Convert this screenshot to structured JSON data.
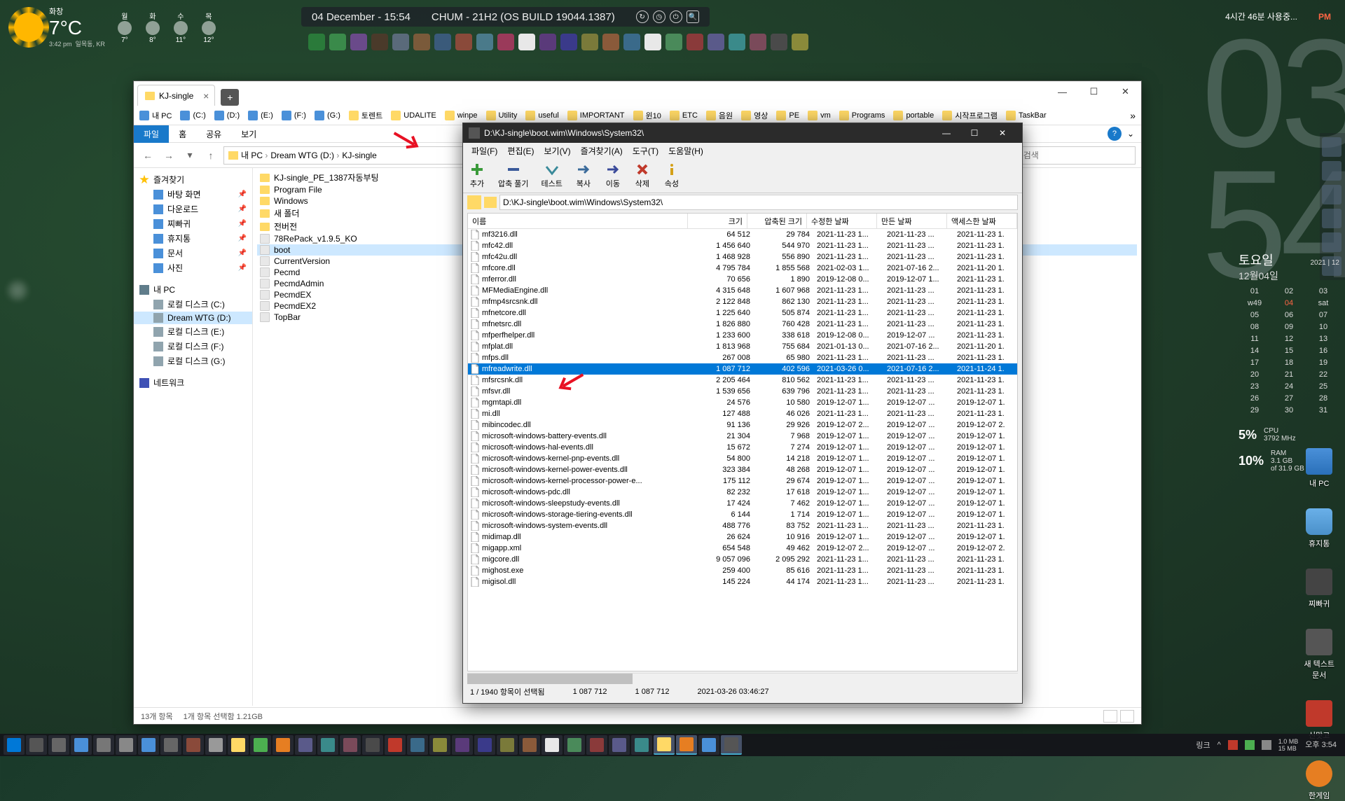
{
  "topbar": {
    "weather_day": "화창",
    "temp": "7°C",
    "sub1": "3:42 pm",
    "sub2": "일목동, KR",
    "forecast_days": [
      "월",
      "화",
      "수",
      "목"
    ],
    "forecast_temps": [
      "7°",
      "8°",
      "11°",
      "12°"
    ],
    "datetime": "04 December - 15:54",
    "build": "CHUM - 21H2 (OS BUILD 19044.1387)",
    "uptime": "4시간 46분 사용중...",
    "pm": "PM"
  },
  "bigclock": {
    "h": "03",
    "m": "54"
  },
  "explorer": {
    "tab_title": "KJ-single",
    "bookmarks": [
      "내 PC",
      "(C:)",
      "(D:)",
      "(E:)",
      "(F:)",
      "(G:)",
      "토렌트",
      "UDALITE",
      "winpe",
      "Utility",
      "useful",
      "IMPORTANT",
      "윈10",
      "ETC",
      "음원",
      "영상",
      "PE",
      "vm",
      "Programs",
      "portable",
      "시작프로그램",
      "TaskBar"
    ],
    "ribbon": [
      "파일",
      "홈",
      "공유",
      "보기"
    ],
    "breadcrumb": [
      "내 PC",
      "Dream WTG (D:)",
      "KJ-single"
    ],
    "search_placeholder": "KJ-single 검색",
    "sidebar": {
      "quick": "즐겨찾기",
      "quick_items": [
        "바탕 화면",
        "다운로드",
        "찌빠귀",
        "휴지통",
        "문서",
        "사진"
      ],
      "pc": "내 PC",
      "drives": [
        "로컬 디스크 (C:)",
        "Dream WTG (D:)",
        "로컬 디스크 (E:)",
        "로컬 디스크 (F:)",
        "로컬 디스크 (G:)"
      ],
      "network": "네트워크"
    },
    "files": [
      {
        "n": "KJ-single_PE_1387자동부팅",
        "t": "fld"
      },
      {
        "n": "Program File",
        "t": "fld"
      },
      {
        "n": "Windows",
        "t": "fld"
      },
      {
        "n": "새 폴더",
        "t": "fld"
      },
      {
        "n": "전버전",
        "t": "fld"
      },
      {
        "n": "78RePack_v1.9.5_KO",
        "t": "fil"
      },
      {
        "n": "boot",
        "t": "fil",
        "sel": true
      },
      {
        "n": "CurrentVersion",
        "t": "fil"
      },
      {
        "n": "Pecmd",
        "t": "fil"
      },
      {
        "n": "PecmdAdmin",
        "t": "fil"
      },
      {
        "n": "PecmdEX",
        "t": "fil"
      },
      {
        "n": "PecmdEX2",
        "t": "fil"
      },
      {
        "n": "TopBar",
        "t": "fil"
      }
    ],
    "status1": "13개 항목",
    "status2": "1개 항목 선택함 1.21GB"
  },
  "zip": {
    "title": "D:\\KJ-single\\boot.wim\\Windows\\System32\\",
    "menu": [
      "파일(F)",
      "편집(E)",
      "보기(V)",
      "즐겨찾기(A)",
      "도구(T)",
      "도움말(H)"
    ],
    "tools": [
      "추가",
      "압축 풀기",
      "테스트",
      "복사",
      "이동",
      "삭제",
      "속성"
    ],
    "addr": "D:\\KJ-single\\boot.wim\\Windows\\System32\\",
    "headers": [
      "이름",
      "크기",
      "압축된 크기",
      "수정한 날짜",
      "만든 날짜",
      "액세스한 날짜"
    ],
    "rows": [
      {
        "n": "mf3216.dll",
        "s": "64 512",
        "p": "29 784",
        "m": "2021-11-23 1...",
        "c": "2021-11-23 ...",
        "a": "2021-11-23 1."
      },
      {
        "n": "mfc42.dll",
        "s": "1 456 640",
        "p": "544 970",
        "m": "2021-11-23 1...",
        "c": "2021-11-23 ...",
        "a": "2021-11-23 1."
      },
      {
        "n": "mfc42u.dll",
        "s": "1 468 928",
        "p": "556 890",
        "m": "2021-11-23 1...",
        "c": "2021-11-23 ...",
        "a": "2021-11-23 1."
      },
      {
        "n": "mfcore.dll",
        "s": "4 795 784",
        "p": "1 855 568",
        "m": "2021-02-03 1...",
        "c": "2021-07-16 2...",
        "a": "2021-11-20 1."
      },
      {
        "n": "mferror.dll",
        "s": "70 656",
        "p": "1 890",
        "m": "2019-12-08 0...",
        "c": "2019-12-07 1...",
        "a": "2021-11-23 1."
      },
      {
        "n": "MFMediaEngine.dll",
        "s": "4 315 648",
        "p": "1 607 968",
        "m": "2021-11-23 1...",
        "c": "2021-11-23 ...",
        "a": "2021-11-23 1."
      },
      {
        "n": "mfmp4srcsnk.dll",
        "s": "2 122 848",
        "p": "862 130",
        "m": "2021-11-23 1...",
        "c": "2021-11-23 ...",
        "a": "2021-11-23 1."
      },
      {
        "n": "mfnetcore.dll",
        "s": "1 225 640",
        "p": "505 874",
        "m": "2021-11-23 1...",
        "c": "2021-11-23 ...",
        "a": "2021-11-23 1."
      },
      {
        "n": "mfnetsrc.dll",
        "s": "1 826 880",
        "p": "760 428",
        "m": "2021-11-23 1...",
        "c": "2021-11-23 ...",
        "a": "2021-11-23 1."
      },
      {
        "n": "mfperfhelper.dll",
        "s": "1 233 600",
        "p": "338 618",
        "m": "2019-12-08 0...",
        "c": "2019-12-07 ...",
        "a": "2021-11-23 1."
      },
      {
        "n": "mfplat.dll",
        "s": "1 813 968",
        "p": "755 684",
        "m": "2021-01-13 0...",
        "c": "2021-07-16 2...",
        "a": "2021-11-20 1."
      },
      {
        "n": "mfps.dll",
        "s": "267 008",
        "p": "65 980",
        "m": "2021-11-23 1...",
        "c": "2021-11-23 ...",
        "a": "2021-11-23 1."
      },
      {
        "n": "mfreadwrite.dll",
        "s": "1 087 712",
        "p": "402 596",
        "m": "2021-03-26 0...",
        "c": "2021-07-16 2...",
        "a": "2021-11-24 1.",
        "sel": true
      },
      {
        "n": "mfsrcsnk.dll",
        "s": "2 205 464",
        "p": "810 562",
        "m": "2021-11-23 1...",
        "c": "2021-11-23 ...",
        "a": "2021-11-23 1."
      },
      {
        "n": "mfsvr.dll",
        "s": "1 539 656",
        "p": "639 796",
        "m": "2021-11-23 1...",
        "c": "2021-11-23 ...",
        "a": "2021-11-23 1."
      },
      {
        "n": "mgmtapi.dll",
        "s": "24 576",
        "p": "10 580",
        "m": "2019-12-07 1...",
        "c": "2019-12-07 ...",
        "a": "2019-12-07 1."
      },
      {
        "n": "mi.dll",
        "s": "127 488",
        "p": "46 026",
        "m": "2021-11-23 1...",
        "c": "2021-11-23 ...",
        "a": "2021-11-23 1."
      },
      {
        "n": "mibincodec.dll",
        "s": "91 136",
        "p": "29 926",
        "m": "2019-12-07 2...",
        "c": "2019-12-07 ...",
        "a": "2019-12-07 2."
      },
      {
        "n": "microsoft-windows-battery-events.dll",
        "s": "21 304",
        "p": "7 968",
        "m": "2019-12-07 1...",
        "c": "2019-12-07 ...",
        "a": "2019-12-07 1."
      },
      {
        "n": "microsoft-windows-hal-events.dll",
        "s": "15 672",
        "p": "7 274",
        "m": "2019-12-07 1...",
        "c": "2019-12-07 ...",
        "a": "2019-12-07 1."
      },
      {
        "n": "microsoft-windows-kernel-pnp-events.dll",
        "s": "54 800",
        "p": "14 218",
        "m": "2019-12-07 1...",
        "c": "2019-12-07 ...",
        "a": "2019-12-07 1."
      },
      {
        "n": "microsoft-windows-kernel-power-events.dll",
        "s": "323 384",
        "p": "48 268",
        "m": "2019-12-07 1...",
        "c": "2019-12-07 ...",
        "a": "2019-12-07 1."
      },
      {
        "n": "microsoft-windows-kernel-processor-power-e...",
        "s": "175 112",
        "p": "29 674",
        "m": "2019-12-07 1...",
        "c": "2019-12-07 ...",
        "a": "2019-12-07 1."
      },
      {
        "n": "microsoft-windows-pdc.dll",
        "s": "82 232",
        "p": "17 618",
        "m": "2019-12-07 1...",
        "c": "2019-12-07 ...",
        "a": "2019-12-07 1."
      },
      {
        "n": "microsoft-windows-sleepstudy-events.dll",
        "s": "17 424",
        "p": "7 462",
        "m": "2019-12-07 1...",
        "c": "2019-12-07 ...",
        "a": "2019-12-07 1."
      },
      {
        "n": "microsoft-windows-storage-tiering-events.dll",
        "s": "6 144",
        "p": "1 714",
        "m": "2019-12-07 1...",
        "c": "2019-12-07 ...",
        "a": "2019-12-07 1."
      },
      {
        "n": "microsoft-windows-system-events.dll",
        "s": "488 776",
        "p": "83 752",
        "m": "2021-11-23 1...",
        "c": "2021-11-23 ...",
        "a": "2021-11-23 1."
      },
      {
        "n": "midimap.dll",
        "s": "26 624",
        "p": "10 916",
        "m": "2019-12-07 1...",
        "c": "2019-12-07 ...",
        "a": "2019-12-07 1."
      },
      {
        "n": "migapp.xml",
        "s": "654 548",
        "p": "49 462",
        "m": "2019-12-07 2...",
        "c": "2019-12-07 ...",
        "a": "2019-12-07 2."
      },
      {
        "n": "migcore.dll",
        "s": "9 057 096",
        "p": "2 095 292",
        "m": "2021-11-23 1...",
        "c": "2021-11-23 ...",
        "a": "2021-11-23 1."
      },
      {
        "n": "mighost.exe",
        "s": "259 400",
        "p": "85 616",
        "m": "2021-11-23 1...",
        "c": "2021-11-23 ...",
        "a": "2021-11-23 1."
      },
      {
        "n": "migisol.dll",
        "s": "145 224",
        "p": "44 174",
        "m": "2021-11-23 1...",
        "c": "2021-11-23 ...",
        "a": "2021-11-23 1."
      }
    ],
    "status": [
      "1 / 1940 항목이 선택됨",
      "1 087 712",
      "1 087 712",
      "2021-03-26 03:46:27"
    ]
  },
  "rightside": {
    "day": "토요일",
    "year": "2021",
    "mon": "12",
    "date": "12월04일",
    "mini_nums": [
      "01",
      "02",
      "03",
      "w49",
      "04",
      "sat",
      "05",
      "06",
      "07",
      "08",
      "09",
      "10",
      "11",
      "12",
      "13",
      "14",
      "15",
      "16",
      "17",
      "18",
      "19",
      "20",
      "21",
      "22",
      "23",
      "24",
      "25",
      "26",
      "27",
      "28",
      "29",
      "30",
      "31"
    ],
    "cpu_pct": "5%",
    "cpu_lbl": "CPU",
    "cpu_sub": "3792 MHz",
    "ram_pct": "10%",
    "ram_lbl": "RAM",
    "ram_sub": "3.1 GB",
    "ram_sub2": "of 31.9 GB"
  },
  "desktop_icons": [
    "내 PC",
    "휴지통",
    "찌빠귀",
    "새 텍스트\n문서",
    "신맛고",
    "한게임"
  ],
  "taskbar": {
    "sys_link": "링크",
    "sys_net": "1.0 MB\n15 MB",
    "clock": "오후 3:54"
  }
}
